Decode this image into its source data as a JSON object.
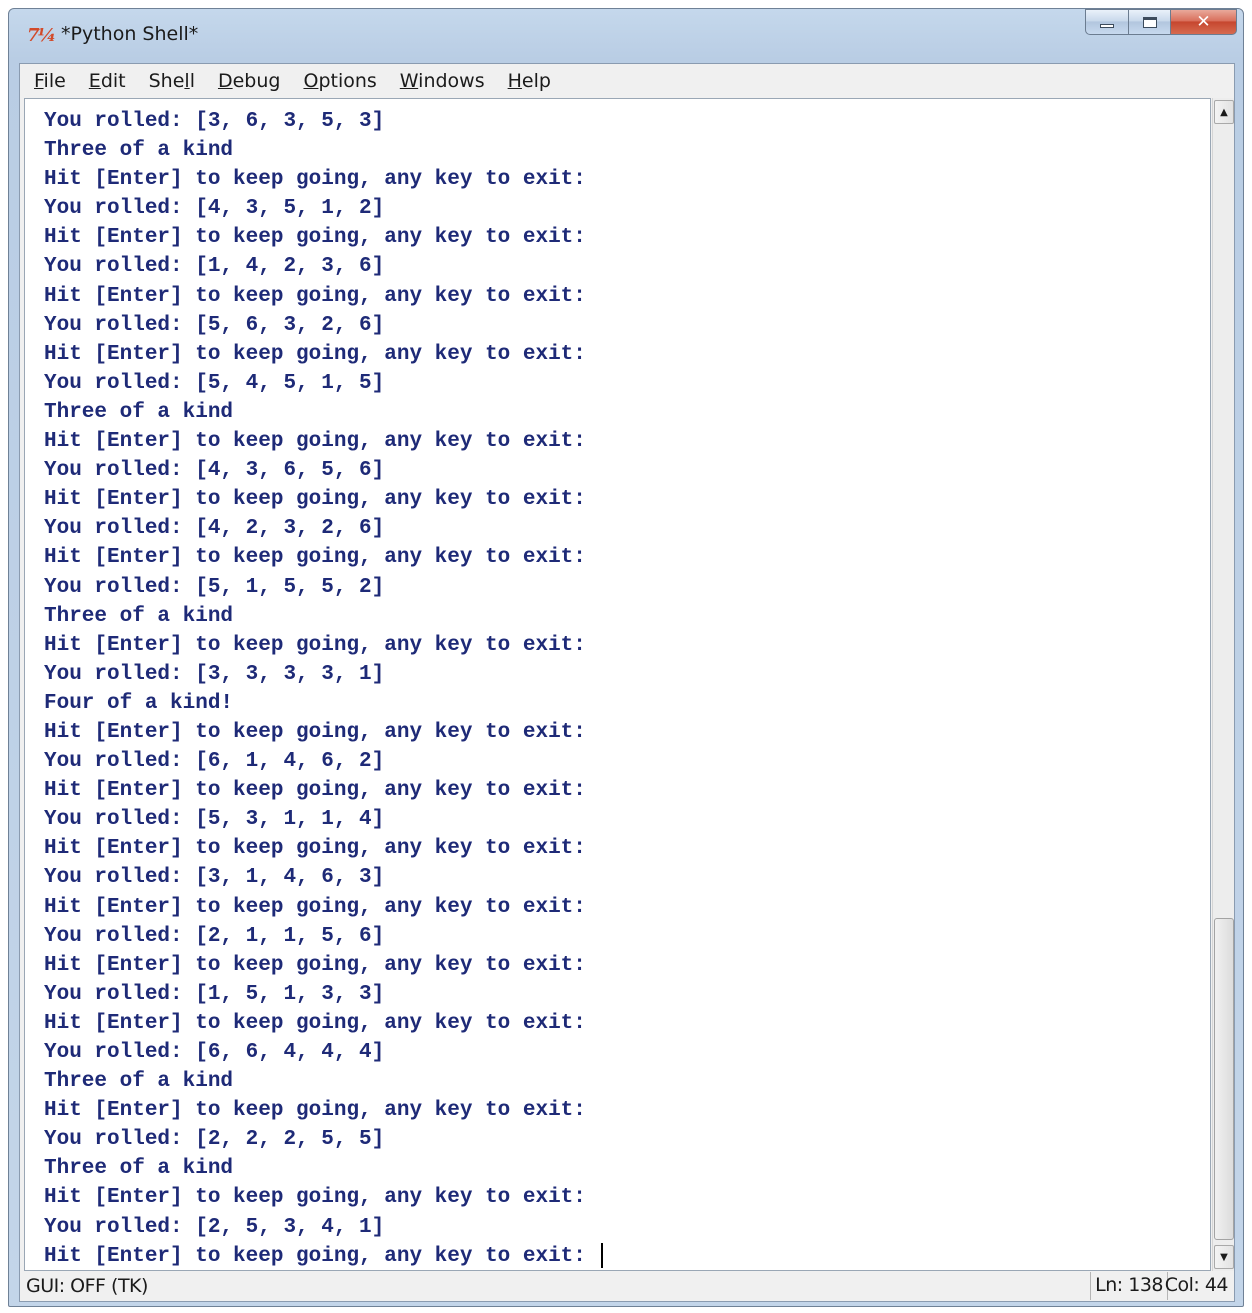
{
  "window": {
    "title": "*Python Shell*",
    "icon": "idle-icon",
    "icon_text": "7¼",
    "close_glyph": "✕"
  },
  "menu": [
    {
      "label": "File",
      "mnemonic": "F"
    },
    {
      "label": "Edit",
      "mnemonic": "E"
    },
    {
      "label": "Shell",
      "mnemonic": "l"
    },
    {
      "label": "Debug",
      "mnemonic": "D"
    },
    {
      "label": "Options",
      "mnemonic": "O"
    },
    {
      "label": "Windows",
      "mnemonic": "W"
    },
    {
      "label": "Help",
      "mnemonic": "H"
    }
  ],
  "shell": {
    "lines": [
      "You rolled: [3, 6, 3, 5, 3]",
      "Three of a kind",
      "Hit [Enter] to keep going, any key to exit:",
      "You rolled: [4, 3, 5, 1, 2]",
      "Hit [Enter] to keep going, any key to exit:",
      "You rolled: [1, 4, 2, 3, 6]",
      "Hit [Enter] to keep going, any key to exit:",
      "You rolled: [5, 6, 3, 2, 6]",
      "Hit [Enter] to keep going, any key to exit:",
      "You rolled: [5, 4, 5, 1, 5]",
      "Three of a kind",
      "Hit [Enter] to keep going, any key to exit:",
      "You rolled: [4, 3, 6, 5, 6]",
      "Hit [Enter] to keep going, any key to exit:",
      "You rolled: [4, 2, 3, 2, 6]",
      "Hit [Enter] to keep going, any key to exit:",
      "You rolled: [5, 1, 5, 5, 2]",
      "Three of a kind",
      "Hit [Enter] to keep going, any key to exit:",
      "You rolled: [3, 3, 3, 3, 1]",
      "Four of a kind!",
      "Hit [Enter] to keep going, any key to exit:",
      "You rolled: [6, 1, 4, 6, 2]",
      "Hit [Enter] to keep going, any key to exit:",
      "You rolled: [5, 3, 1, 1, 4]",
      "Hit [Enter] to keep going, any key to exit:",
      "You rolled: [3, 1, 4, 6, 3]",
      "Hit [Enter] to keep going, any key to exit:",
      "You rolled: [2, 1, 1, 5, 6]",
      "Hit [Enter] to keep going, any key to exit:",
      "You rolled: [1, 5, 1, 3, 3]",
      "Hit [Enter] to keep going, any key to exit:",
      "You rolled: [6, 6, 4, 4, 4]",
      "Three of a kind",
      "Hit [Enter] to keep going, any key to exit:",
      "You rolled: [2, 2, 2, 5, 5]",
      "Three of a kind",
      "Hit [Enter] to keep going, any key to exit:",
      "You rolled: [2, 5, 3, 4, 1]",
      "Hit [Enter] to keep going, any key to exit: "
    ],
    "text_color": "#1e2a77"
  },
  "scrollbar": {
    "up_glyph": "▲",
    "down_glyph": "▼"
  },
  "status": {
    "left": "GUI: OFF (TK)",
    "line": "Ln: 138",
    "col": "Col: 44"
  }
}
